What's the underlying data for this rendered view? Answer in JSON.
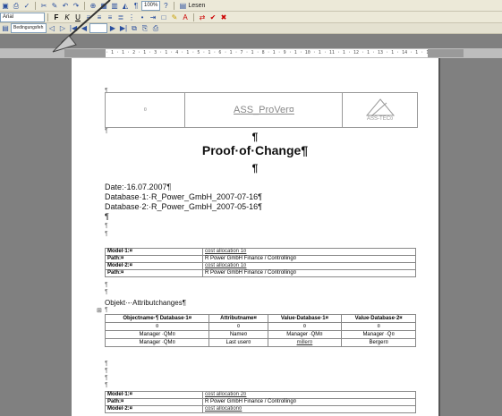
{
  "toolbar": {
    "font_name": "Arial",
    "zoom": "100%",
    "reading_mode": "Lesen",
    "style_box": "Bedingungsfeh"
  },
  "ruler": {
    "scale": "· 1 · 1 · 2 · 1 · 3 · 1 · 4 · 1 · 5 · 1 · 6 · 1 · 7 · 1 · 8 · 1 · 9 · 1 · 10 · 1 · 11 · 1 · 12 · 1 · 13 · 1 · 14 · 1 · 15 · 1 · 16 · 1 ·"
  },
  "document": {
    "pilcrow": "¶",
    "header": {
      "cell1": "¤",
      "cell2": "ASS_ProVer¤",
      "logo_text": "ASS-TEC¤"
    },
    "title": "Proof·of·Change¶",
    "date": "Date:·16.07.2007¶",
    "db1": "Database·1:·R_Power_GmbH_2007-07-16¶",
    "db2": "Database·2:·R_Power_GmbH_2007-05-16¶",
    "model_table_1": [
      {
        "label": "Model·1:¤",
        "value": "cost allocation 1¤"
      },
      {
        "label": "Path:¤",
        "value": "R Power GmbH Finance / Controlling¤"
      },
      {
        "label": "Model·2:¤",
        "value": "cost allocation 1¤"
      },
      {
        "label": "Path:¤",
        "value": "R Power GmbH Finance / Controlling¤"
      }
    ],
    "objekt_heading": "Objekt·-·Attributchanges¶",
    "attr_table": {
      "headers": [
        "Objectname·¶ Database·1¤",
        "Attributname¤",
        "Value·Database·1¤",
        "Value·Database·2¤"
      ],
      "rows": [
        [
          "¤",
          "¤",
          "¤",
          "¤"
        ],
        [
          "Manager ·QM¤",
          "Name¤",
          "Manager ·QM¤",
          "Manager ·Q¤"
        ],
        [
          "Manager ·QM¤",
          "Last user¤",
          "miller¤",
          "Berger¤"
        ]
      ]
    },
    "model_table_2": [
      {
        "label": "Model·1:¤",
        "value": "cost allocation 2¤"
      },
      {
        "label": "Path:¤",
        "value": "R Power GmbH Finance / Controlling¤"
      },
      {
        "label": "Model·2:¤",
        "value": "cost allocation¤"
      }
    ]
  }
}
